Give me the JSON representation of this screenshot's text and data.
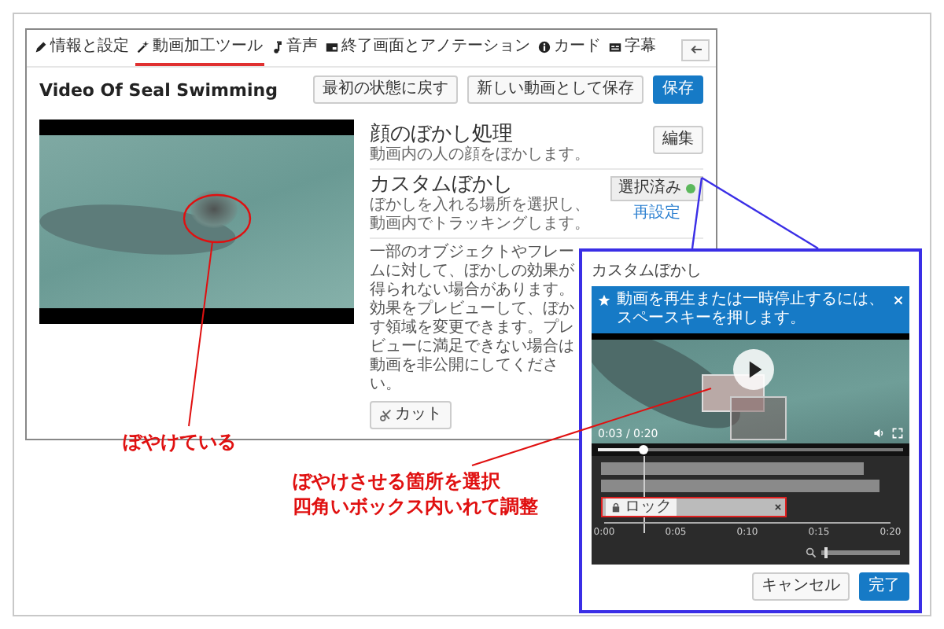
{
  "tabs": [
    {
      "label": "情報と設定",
      "kind": "pencil",
      "selected": false
    },
    {
      "label": "動画加工ツール",
      "kind": "wand",
      "selected": true
    },
    {
      "label": "音声",
      "kind": "note",
      "selected": false
    },
    {
      "label": "終了画面とアノテーション",
      "kind": "screen",
      "selected": false
    },
    {
      "label": "カード",
      "kind": "info",
      "selected": false
    },
    {
      "label": "字幕",
      "kind": "cc",
      "selected": false
    }
  ],
  "video_title": "Video Of Seal Swimming",
  "header_buttons": [
    {
      "label": "最初の状態に戻す",
      "primary": false
    },
    {
      "label": "新しい動画として保存",
      "primary": false
    },
    {
      "label": "保存",
      "primary": true
    }
  ],
  "blur_options": [
    {
      "title": "顔のぼかし処理",
      "description": "動画内の人の顔をぼかします。",
      "button": "編集"
    },
    {
      "title": "カスタムぼかし",
      "description": "ぼかしを入れる場所を選択し、動画内でトラッキングします。",
      "status": "選択済み",
      "link": "再設定"
    }
  ],
  "notice": "一部のオブジェクトやフレームに対して、ぼかしの効果が得られない場合があります。効果をプレビューして、ぼかす領域を変更できます。プレビューに満足できない場合は動画を非公開にしてください。",
  "cut_button": "カット",
  "popup": {
    "title": "カスタムぼかし",
    "banner": "動画を再生または一時停止するには、スペースキーを押します。",
    "time": "0:03 / 0:20",
    "progress": {
      "level": 0.15
    },
    "timeline": {
      "lock_label": "ロック",
      "ticks": [
        "0:00",
        "0:05",
        "0:10",
        "0:15",
        "0:20"
      ],
      "zoom": {
        "level": 0.04
      }
    },
    "buttons": [
      {
        "label": "キャンセル",
        "primary": false
      },
      {
        "label": "完了",
        "primary": true
      }
    ]
  },
  "annotations": [
    {
      "lines": [
        "ぼやけている"
      ]
    },
    {
      "lines": [
        "ぼやけさせる箇所を選択",
        "四角いボックス内いれて調整"
      ]
    }
  ]
}
